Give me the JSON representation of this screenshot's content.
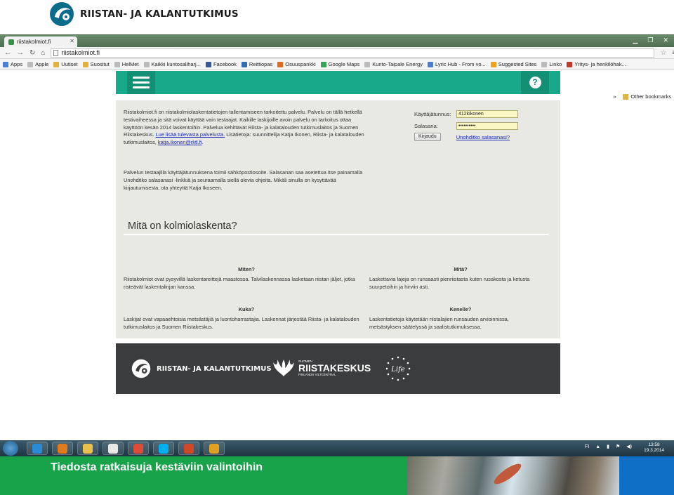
{
  "slide": {
    "logo_text": "RIISTAN- JA KALANTUTKIMUS",
    "banner_text": "Tiedosta ratkaisuja kestäviin valintoihin",
    "colors": {
      "green": "#18a34a",
      "teal": "#17a98a",
      "dark": "#3a3c3e",
      "blue": "#0f6ec6"
    }
  },
  "browser": {
    "tab_title": "riistakolmiot.fi",
    "url": "riistakolmiot.fi",
    "nav_icons": [
      "back-icon",
      "forward-icon",
      "reload-icon",
      "home-icon"
    ],
    "bookmarks": [
      {
        "label": "Apps",
        "icon": "apps-icon",
        "color": "#4a7fd6"
      },
      {
        "label": "Apple",
        "icon": "page-icon",
        "color": "#bbbbbb"
      },
      {
        "label": "Uutiset",
        "icon": "folder-icon",
        "color": "#e2b23c"
      },
      {
        "label": "Suositut",
        "icon": "folder-icon",
        "color": "#e2b23c"
      },
      {
        "label": "HelMet",
        "icon": "page-icon",
        "color": "#bbbbbb"
      },
      {
        "label": "Kaikki kuntosaliharj...",
        "icon": "page-icon",
        "color": "#bbbbbb"
      },
      {
        "label": "Facebook",
        "icon": "facebook-icon",
        "color": "#3b5998"
      },
      {
        "label": "Reittiopas",
        "icon": "gear-icon",
        "color": "#2f6fb0"
      },
      {
        "label": "Osuuspankki",
        "icon": "op-icon",
        "color": "#e06b1a"
      },
      {
        "label": "Google Maps",
        "icon": "maps-icon",
        "color": "#3aa455"
      },
      {
        "label": "Kunto-Taipale Energy",
        "icon": "page-icon",
        "color": "#bbbbbb"
      },
      {
        "label": "Lyric Hub - From vo...",
        "icon": "play-icon",
        "color": "#4d7fd1"
      },
      {
        "label": "Suggested Sites",
        "icon": "suggested-icon",
        "color": "#f0a21c"
      },
      {
        "label": "Linko",
        "icon": "page-icon",
        "color": "#bbbbbb"
      },
      {
        "label": "Yritys- ja henkilöhak...",
        "icon": "page-icon",
        "color": "#c0392b"
      }
    ],
    "other_bookmarks": "Other bookmarks"
  },
  "site": {
    "intro_text": "Riistakolmiot.fi on riistakolmiolaskentatietojen tallentamiseen tarkoitettu palvelu. Palvelu on tällä hetkellä testivaiheessa ja sitä voivat käyttää vain testaajat. Kaikille laskijoille avoin palvelu on tarkoitus ottaa käyttöön kesän 2014 laskentoihin. Palvelua kehittävät Riista- ja kalatalouden tutkimuslaitos ja Suomen Riistakeskus.",
    "intro_link": "Lue lisää tulevasta palvelusta.",
    "intro_contact": "Lisätietoja: suunnittelija Katja Ikonen, Riista- ja kalatalouden tutkimuslaitos,",
    "intro_email": "katja.ikonen@rktl.fi",
    "intro_end": ".",
    "intro2_text": "Palvelun testaajilla käyttäjätunnuksena toimii sähköpostiosoite. Salasanan saa asetettua itse painamalla Unohditko salasanasi -linkkiä ja seuraamalla siellä olevia ohjeita. Mikäli sinulla on kysyttävää kirjautumisesta, ota yhteyttä Katja Ikoseen.",
    "login": {
      "username_label": "Käyttäjätunnus:",
      "username_value": "412kikonen",
      "password_label": "Salasana:",
      "password_value": "••••••••••",
      "login_button": "Kirjaudu",
      "forgot_link": "Unohditko salasanasi?"
    },
    "section_title": "Mitä on kolmiolaskenta?",
    "columns": [
      {
        "title": "Miten?",
        "text": "Riistakolmiot ovat pysyvillä laskentareittejä maastossa. Talvilaskennassa lasketaan riistan jäljet, jotka risteävät laskentalinjan kanssa."
      },
      {
        "title": "Mitä?",
        "text": "Laskettavia lajeja on runsaasti pienriistasta kuten rusakosta ja ketusta suurpetoihin ja hirviin asti."
      },
      {
        "title": "Kuka?",
        "text": "Laskijat ovat vapaaehtoisia metsästäjiä ja luontoharrastajia. Laskennat järjestää Riista- ja kalatalouden tutkimuslaitos ja Suomen Riistakeskus."
      },
      {
        "title": "Kenelle?",
        "text": "Laskentatietoja käytetään riistalajien runsauden arvioinnissa, metsästyksen säätelyssä ja saalistutkimuksessa."
      }
    ],
    "footer": {
      "logo1_text": "RIISTAN- JA KALANTUTKIMUS",
      "logo2_small": "SUOMEN",
      "logo2_main": "RIISTAKESKUS",
      "logo2_sub": "FINLANDS VILTCENTRAL",
      "logo3_text": "Life"
    }
  },
  "taskbar": {
    "apps": [
      {
        "icon": "ie-icon",
        "color": "#2b8ad6"
      },
      {
        "icon": "media-player-icon",
        "color": "#e07a1a"
      },
      {
        "icon": "explorer-icon",
        "color": "#e8c04a"
      },
      {
        "icon": "document-icon",
        "color": "#e8e8e8"
      },
      {
        "icon": "chrome-icon",
        "color": "#dd4b39"
      },
      {
        "icon": "skype-icon",
        "color": "#00aff0"
      },
      {
        "icon": "powerpoint-icon",
        "color": "#d24726"
      },
      {
        "icon": "outlook-icon",
        "color": "#e0a020"
      }
    ],
    "language": "FI",
    "time": "13:58",
    "date": "19.3.2014"
  }
}
